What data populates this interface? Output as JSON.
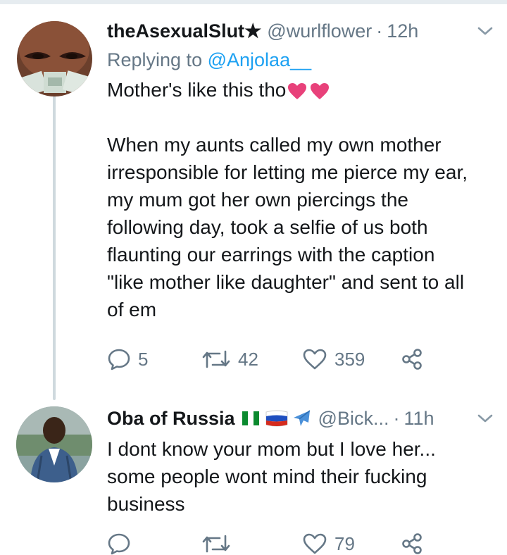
{
  "tweets": [
    {
      "name": "theAsexualSlut",
      "name_suffix": "★",
      "handle": "@wurlflower",
      "time": "12h",
      "replying_to_label": "Replying to",
      "replying_to_user": "@Anjolaa__",
      "text_line1": "Mother's like this tho",
      "text_body": "When my aunts called my own mother\nirresponsible for letting me pierce my ear,\nmy mum got her own piercings the\nfollowing day, took a selfie of us both\nflaunting our earrings with the caption\n\"like mother like daughter\" and sent to all\nof em",
      "replies": "5",
      "retweets": "42",
      "likes": "359"
    },
    {
      "name": "Oba of Russia",
      "handle": "@Bick...",
      "time": "11h",
      "text": "I dont know your mom but I love her...\nsome people wont mind their fucking\nbusiness",
      "likes": "79"
    }
  ],
  "icons": {
    "reply": "speech-bubble-icon",
    "retweet": "retweet-icon",
    "like": "heart-icon",
    "share": "share-icon",
    "menu": "chevron-down-icon"
  },
  "colors": {
    "accent": "#1da1f2",
    "heart_emoji": "#e8417a",
    "muted": "#657786"
  }
}
